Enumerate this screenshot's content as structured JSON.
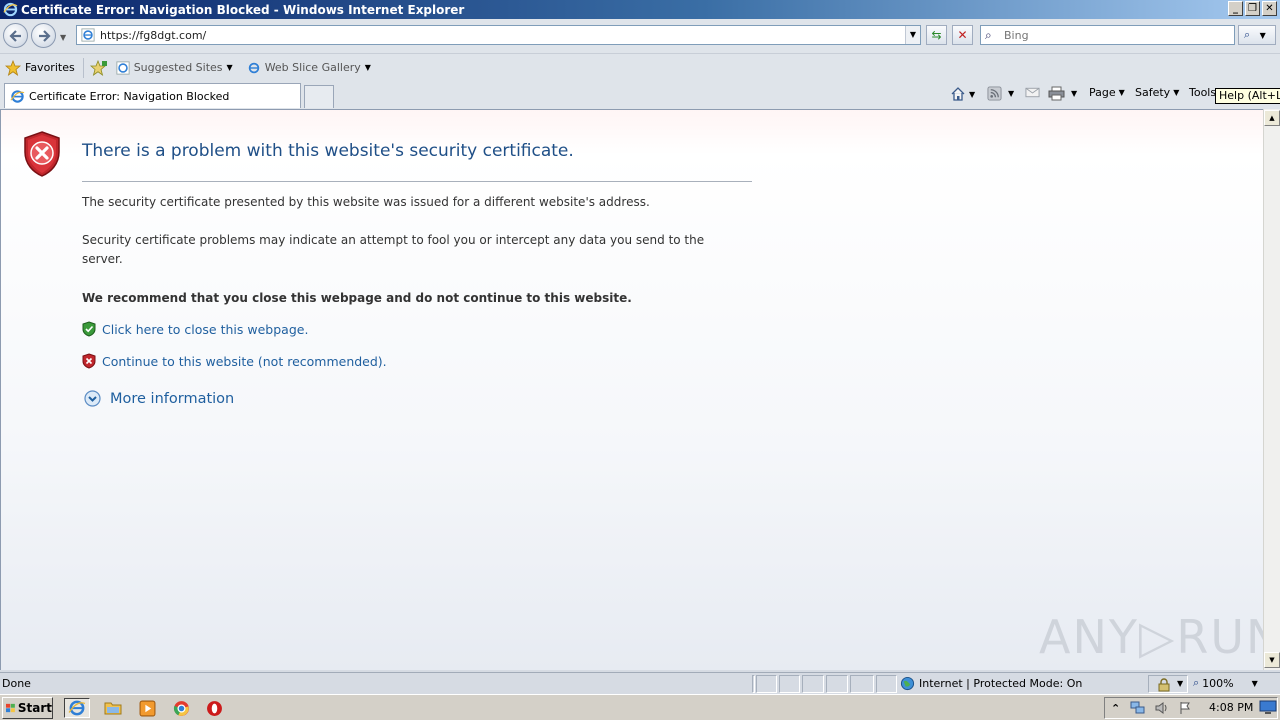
{
  "window": {
    "title": "Certificate Error: Navigation Blocked - Windows Internet Explorer",
    "controls": [
      "_",
      "❐",
      "✕"
    ]
  },
  "navigation": {
    "url": "https://fg8dgt.com/",
    "search_placeholder": "Bing"
  },
  "favorites_bar": {
    "favorites_label": "Favorites",
    "items": [
      {
        "label": "Suggested Sites"
      },
      {
        "label": "Web Slice Gallery"
      }
    ]
  },
  "tab": {
    "label": "Certificate Error: Navigation Blocked"
  },
  "command_bar": {
    "page_label": "Page",
    "safety_label": "Safety",
    "tools_label": "Tools",
    "tooltip": "Help (Alt+L)"
  },
  "content": {
    "headline": "There is a problem with this website's security certificate.",
    "para1": "The security certificate presented by this website was issued for a different website's address.",
    "para2": "Security certificate problems may indicate an attempt to fool you or intercept any data you send to the server.",
    "recommend": "We recommend that you close this webpage and do not continue to this website.",
    "close_link": "Click here to close this webpage.",
    "continue_link": "Continue to this website (not recommended).",
    "more_info": "More information",
    "watermark": "ANY▷RUN"
  },
  "status_bar": {
    "status": "Done",
    "zone": "Internet | Protected Mode: On",
    "zoom": "100%"
  },
  "taskbar": {
    "start_label": "Start",
    "clock": "4:08 PM"
  },
  "colors": {
    "link": "#1f5f9f",
    "headline": "#1f4f87",
    "shield_red": "#c0262c",
    "shield_green": "#3a9a3a"
  }
}
